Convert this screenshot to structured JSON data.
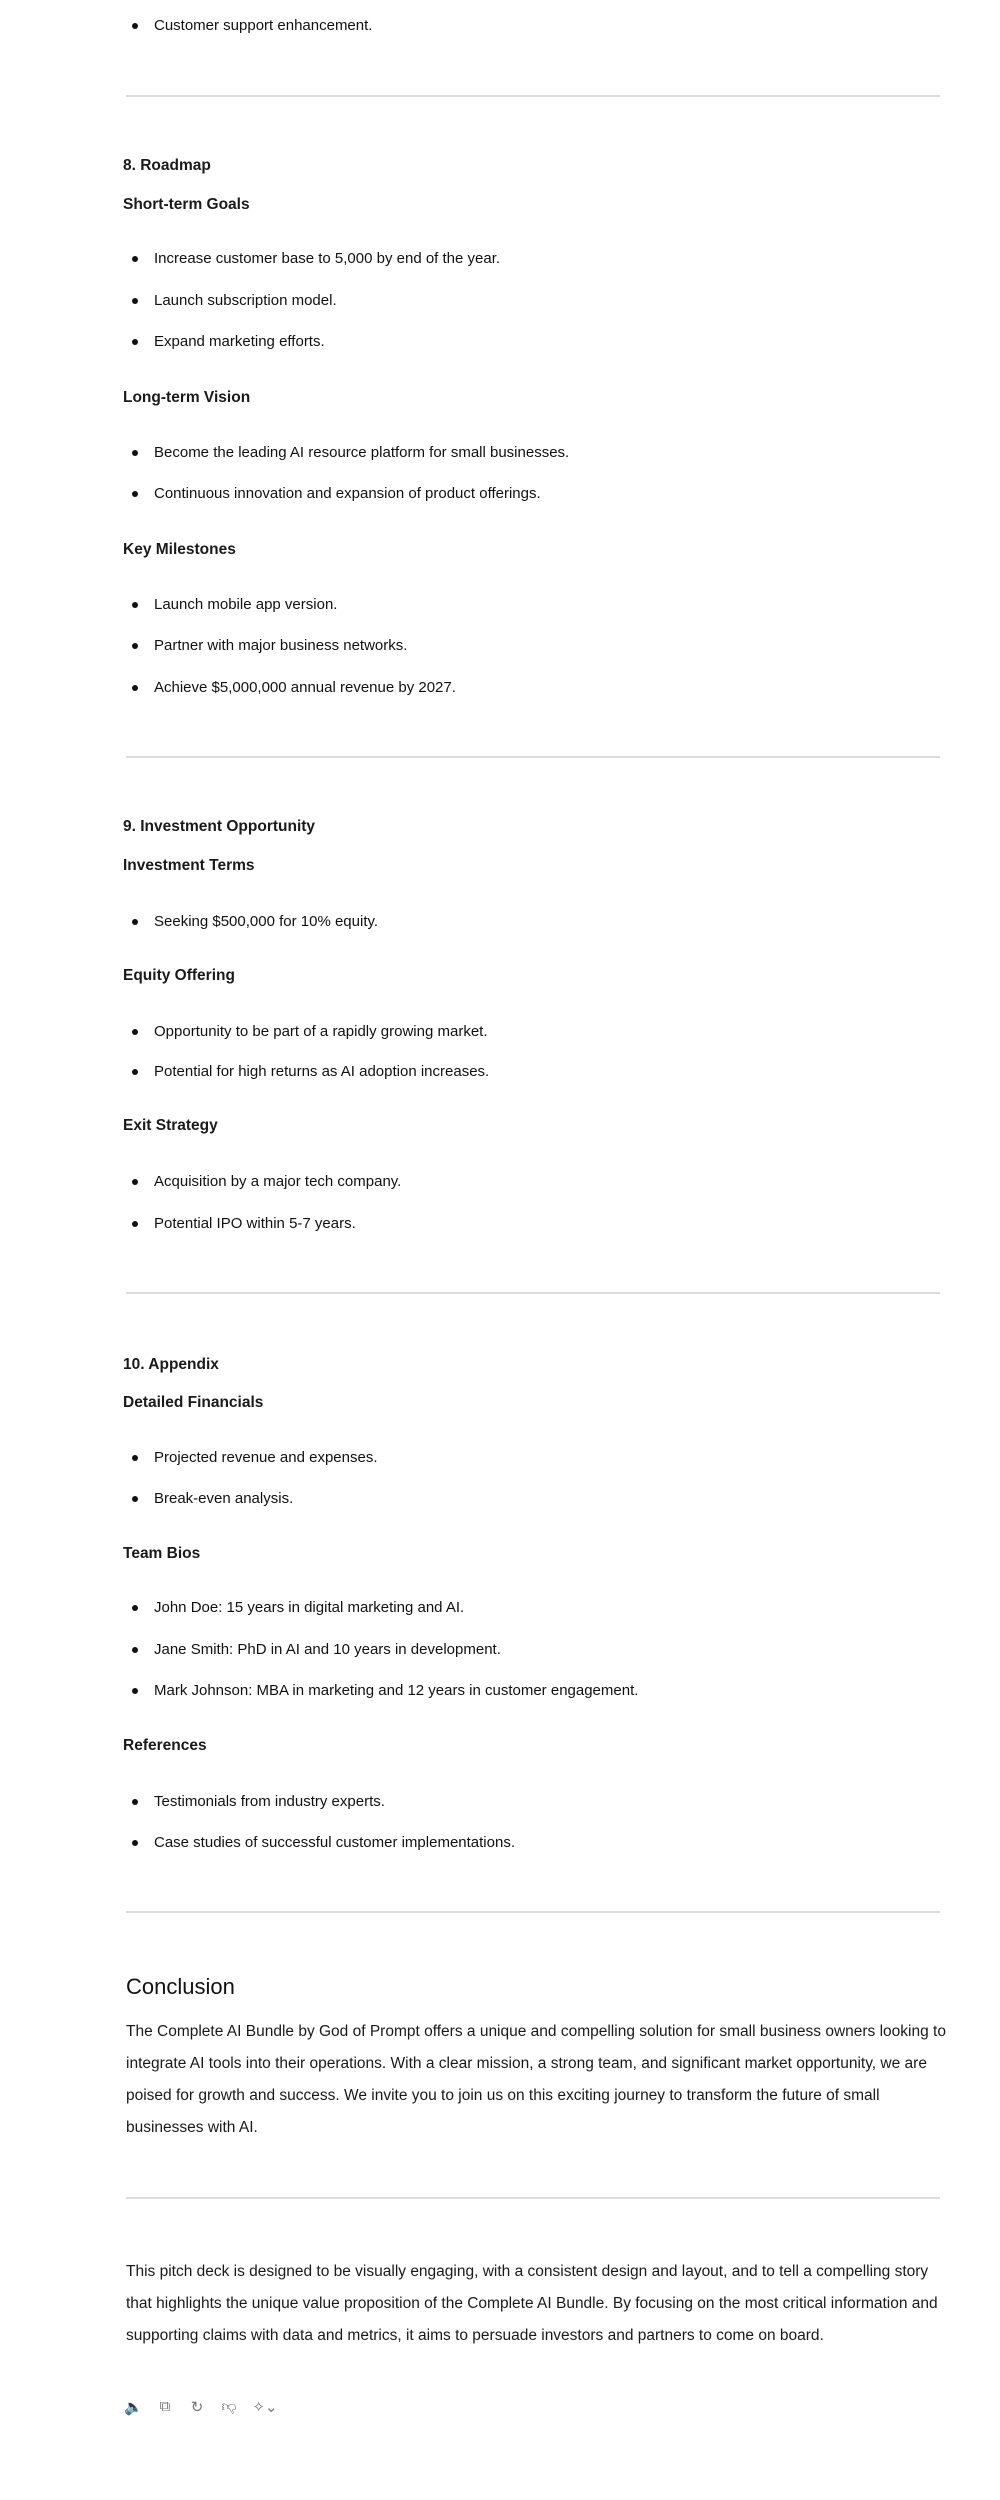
{
  "prev_item": "Customer support enhancement.",
  "roadmap": {
    "title": "8. Roadmap",
    "short_term": {
      "title": "Short-term Goals",
      "items": [
        "Increase customer base to 5,000 by end of the year.",
        "Launch subscription model.",
        "Expand marketing efforts."
      ]
    },
    "long_term": {
      "title": "Long-term Vision",
      "items": [
        "Become the leading AI resource platform for small businesses.",
        "Continuous innovation and expansion of product offerings."
      ]
    },
    "milestones": {
      "title": "Key Milestones",
      "items": [
        "Launch mobile app version.",
        "Partner with major business networks.",
        "Achieve $5,000,000 annual revenue by 2027."
      ]
    }
  },
  "investment": {
    "title": "9. Investment Opportunity",
    "terms": {
      "title": "Investment Terms",
      "items": [
        "Seeking $500,000 for 10% equity."
      ]
    },
    "equity": {
      "title": "Equity Offering",
      "items": [
        "Opportunity to be part of a rapidly growing market.",
        "Potential for high returns as AI adoption increases."
      ]
    },
    "exit": {
      "title": "Exit Strategy",
      "items": [
        "Acquisition by a major tech company.",
        "Potential IPO within 5-7 years."
      ]
    }
  },
  "appendix": {
    "title": "10. Appendix",
    "financials": {
      "title": "Detailed Financials",
      "items": [
        "Projected revenue and expenses.",
        "Break-even analysis."
      ]
    },
    "team": {
      "title": "Team Bios",
      "items": [
        "John Doe: 15 years in digital marketing and AI.",
        "Jane Smith: PhD in AI and 10 years in development.",
        "Mark Johnson: MBA in marketing and 12 years in customer engagement."
      ]
    },
    "references": {
      "title": "References",
      "items": [
        "Testimonials from industry experts.",
        "Case studies of successful customer implementations."
      ]
    }
  },
  "conclusion": {
    "title": "Conclusion",
    "text": "The Complete AI Bundle by God of Prompt offers a unique and compelling solution for small business owners looking to integrate AI tools into their operations. With a clear mission, a strong team, and significant market opportunity, we are poised for growth and success. We invite you to join us on this exciting journey to transform the future of small businesses with AI."
  },
  "footer_text": "This pitch deck is designed to be visually engaging, with a consistent design and layout, and to tell a compelling story that highlights the unique value proposition of the Complete AI Bundle. By focusing on the most critical information and supporting claims with data and metrics, it aims to persuade investors and partners to come on board.",
  "actions": [
    "read-aloud-icon",
    "copy-icon",
    "regenerate-icon",
    "thumbs-down-icon",
    "model-switch-icon"
  ]
}
